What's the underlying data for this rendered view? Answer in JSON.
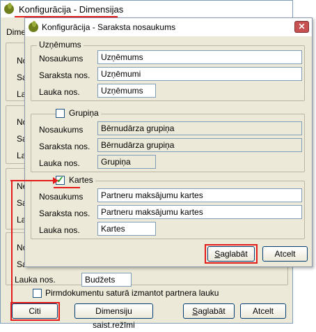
{
  "back_window": {
    "title": "Konfigurācija - Dimensijas",
    "dimen_label": "Dimen",
    "rows_a": [
      "No",
      "Sa",
      "La"
    ],
    "rows_b": [
      "No",
      "Sa",
      "La"
    ],
    "rows_c": [
      "Ne",
      "Sa",
      "La"
    ],
    "rows_d": [
      "No",
      "Sa"
    ],
    "lauka_label": "Lauka nos.",
    "lauka_value": "Budžets",
    "partner_checkbox_label": "Pirmdokumentu saturā izmantot partnera lauku",
    "partner_checked": false,
    "btn_citi": "Citi",
    "btn_dimensiju": "Dimensiju saist.režīmi",
    "btn_saglabat_pre": "",
    "btn_saglabat_u": "S",
    "btn_saglabat_post": "aglabāt",
    "btn_atcelt": "Atcelt"
  },
  "dialog": {
    "title": "Konfigurācija - Saraksta nosaukums",
    "close_glyph": "✕",
    "groups": [
      {
        "legend": "Uzņēmums",
        "has_checkbox": false,
        "rows": [
          {
            "label": "Nosaukums",
            "value": "Uzņēmums"
          },
          {
            "label": "Saraksta nos.",
            "value": "Uzņēmumi"
          },
          {
            "label": "Lauka nos.",
            "value": "Uzņēmums"
          }
        ]
      },
      {
        "legend": "Grupiņa",
        "has_checkbox": true,
        "checked": false,
        "rows": [
          {
            "label": "Nosaukums",
            "value": "Bērnudārza grupiņa"
          },
          {
            "label": "Saraksta nos.",
            "value": "Bērnudārza grupiņa"
          },
          {
            "label": "Lauka nos.",
            "value": "Grupiņa"
          }
        ]
      },
      {
        "legend": "Kartes",
        "has_checkbox": true,
        "checked": true,
        "rows": [
          {
            "label": "Nosaukums",
            "value": "Partneru maksājumu kartes"
          },
          {
            "label": "Saraksta nos.",
            "value": "Partneru maksājumu kartes"
          },
          {
            "label": "Lauka nos.",
            "value": "Kartes"
          }
        ]
      }
    ],
    "btn_saglabat_u": "S",
    "btn_saglabat_post": "aglabāt",
    "btn_atcelt": "Atcelt"
  },
  "colors": {
    "highlight": "#e41b1b",
    "logo": "#6e7f1c"
  }
}
